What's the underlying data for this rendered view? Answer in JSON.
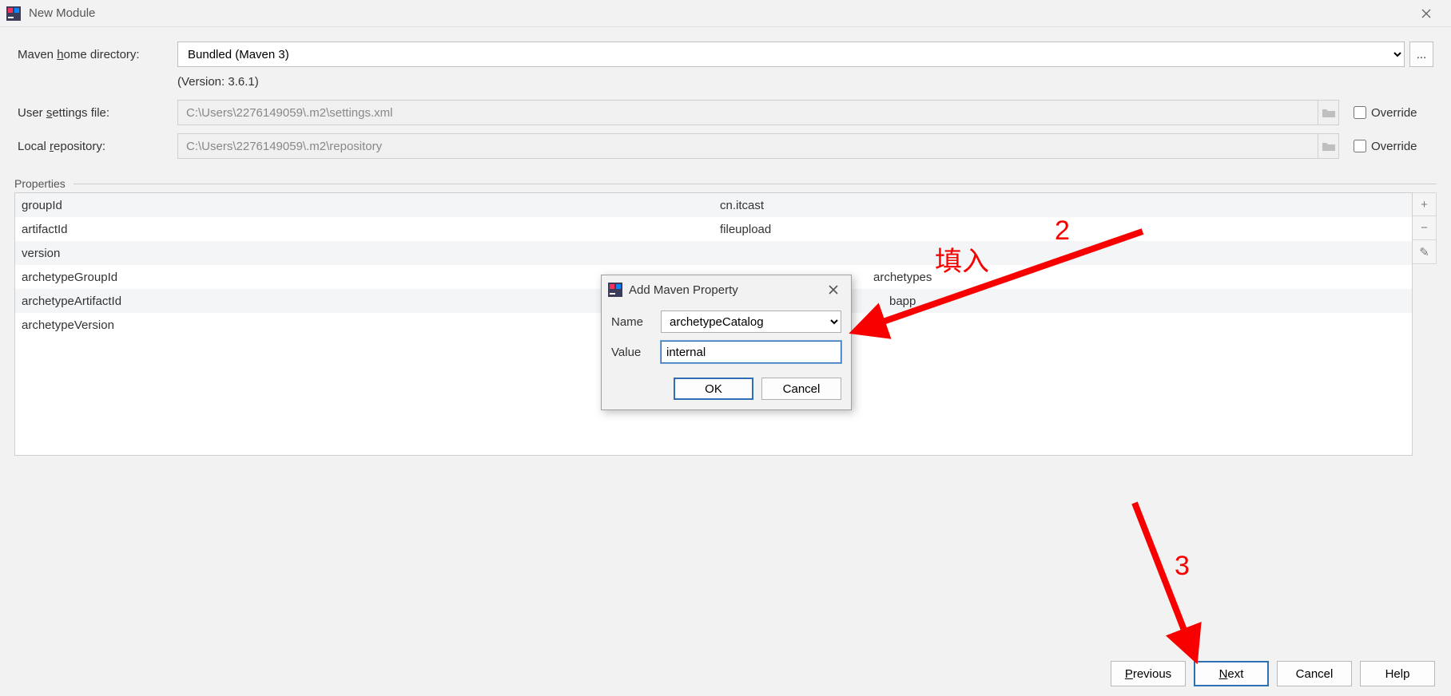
{
  "window": {
    "title": "New Module"
  },
  "form": {
    "maven_home_label": "Maven home directory:",
    "maven_home_value": "Bundled (Maven 3)",
    "version_hint": "(Version: 3.6.1)",
    "user_settings_label": "User settings file:",
    "user_settings_value": "C:\\Users\\2276149059\\.m2\\settings.xml",
    "local_repo_label": "Local repository:",
    "local_repo_value": "C:\\Users\\2276149059\\.m2\\repository",
    "override_label": "Override",
    "browse_label": "..."
  },
  "properties": {
    "section_label": "Properties",
    "rows": [
      {
        "key": "groupId",
        "value": "cn.itcast"
      },
      {
        "key": "artifactId",
        "value": "fileupload"
      },
      {
        "key": "version",
        "value": ""
      },
      {
        "key": "archetypeGroupId",
        "value": "archetypes"
      },
      {
        "key": "archetypeArtifactId",
        "value": "bapp"
      },
      {
        "key": "archetypeVersion",
        "value": ""
      }
    ],
    "tools": {
      "add": "+",
      "remove": "−",
      "edit": "✎"
    }
  },
  "footer": {
    "previous": "Previous",
    "next": "Next",
    "cancel": "Cancel",
    "help": "Help"
  },
  "modal": {
    "title": "Add Maven Property",
    "name_label": "Name",
    "name_value": "archetypeCatalog",
    "value_label": "Value",
    "value_value": "internal",
    "ok": "OK",
    "cancel": "Cancel"
  },
  "annotations": {
    "fill_in": "填入",
    "step2": "2",
    "step3": "3"
  }
}
